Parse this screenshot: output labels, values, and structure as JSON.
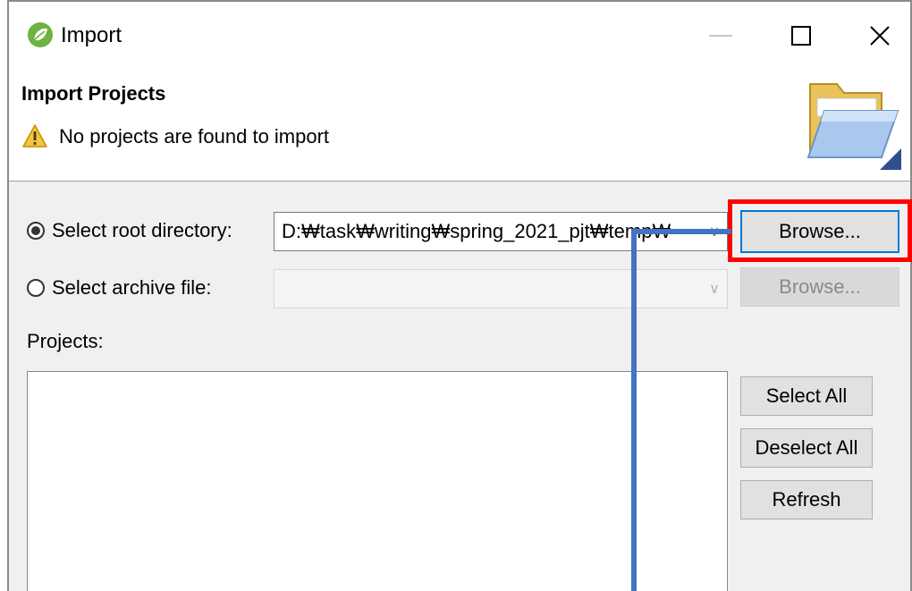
{
  "window": {
    "title": "Import",
    "icons": {
      "app": "spring-leaf-icon",
      "minimize": "minimize-icon",
      "maximize": "maximize-icon",
      "close": "close-icon"
    }
  },
  "header": {
    "title": "Import Projects",
    "message": "No projects are found to import",
    "icons": {
      "warning": "warning-icon",
      "folder": "folder-icon"
    }
  },
  "source": {
    "root_dir_label": "Select root directory:",
    "root_dir_value": "D:₩task₩writing₩spring_2021_pjt₩temp₩",
    "root_dir_selected": true,
    "archive_label": "Select archive file:",
    "archive_value": "",
    "browse_label": "Browse...",
    "browse_disabled_label": "Browse..."
  },
  "projects": {
    "label": "Projects:",
    "items": [],
    "buttons": {
      "select_all": "Select All",
      "deselect_all": "Deselect All",
      "refresh": "Refresh"
    }
  },
  "colors": {
    "highlight_box": "#ff0000",
    "connector_line": "#4472c4",
    "focus_border": "#0078d7"
  }
}
